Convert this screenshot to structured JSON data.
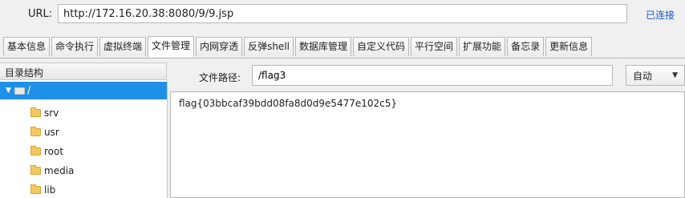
{
  "url_bar": {
    "label": "URL:",
    "value": "http://172.16.20.38:8080/9/9.jsp",
    "status": "已连接"
  },
  "tabs": [
    {
      "label": "基本信息"
    },
    {
      "label": "命令执行"
    },
    {
      "label": "虚拟终端"
    },
    {
      "label": "文件管理",
      "active": true
    },
    {
      "label": "内网穿透"
    },
    {
      "label": "反弹shell"
    },
    {
      "label": "数据库管理"
    },
    {
      "label": "自定义代码"
    },
    {
      "label": "平行空间"
    },
    {
      "label": "扩展功能"
    },
    {
      "label": "备忘录"
    },
    {
      "label": "更新信息"
    }
  ],
  "tree": {
    "header": "目录结构",
    "root": "/",
    "items": [
      "srv",
      "usr",
      "root",
      "media",
      "lib"
    ]
  },
  "file_path": {
    "label": "文件路径:",
    "value": "/flag3"
  },
  "encoding": {
    "selected": "自动"
  },
  "file_content": "flag{03bbcaf39bdd08fa8d0d9e5477e102c5}",
  "colors": {
    "selection": "#1e90e8",
    "link_status": "#1a55d6",
    "folder": "#f3c862"
  }
}
